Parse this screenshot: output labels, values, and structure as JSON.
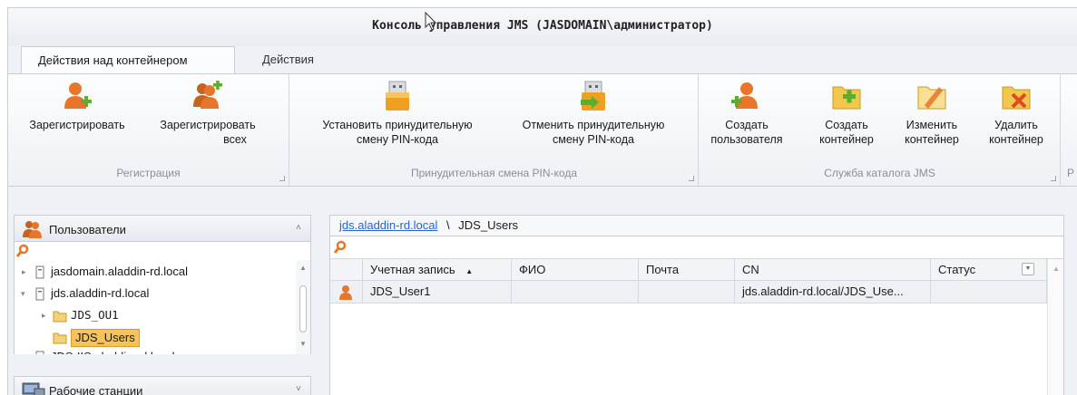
{
  "window": {
    "title": "Консоль управления JMS (JASDOMAIN\\администратор)"
  },
  "tabs": [
    {
      "label": "Действия над контейнером",
      "active": true
    },
    {
      "label": "Действия",
      "active": false
    }
  ],
  "ribbon": {
    "groups": [
      {
        "label": "Регистрация",
        "buttons": [
          {
            "line1": "Зарегистрировать",
            "line2": "",
            "icon": "register-user-icon"
          },
          {
            "line1": "Зарегистрировать",
            "line2": "всех",
            "icon": "register-all-users-icon"
          }
        ]
      },
      {
        "label": "Принудительная смена PIN-кода",
        "buttons": [
          {
            "line1": "Установить принудительную",
            "line2": "смену PIN-кода",
            "icon": "token-pin-set-icon"
          },
          {
            "line1": "Отменить принудительную",
            "line2": "смену PIN-кода",
            "icon": "token-pin-cancel-icon"
          }
        ]
      },
      {
        "label": "Служба каталога JMS",
        "buttons": [
          {
            "line1": "Создать",
            "line2": "пользователя",
            "icon": "create-user-icon"
          },
          {
            "line1": "Создать",
            "line2": "контейнер",
            "icon": "create-container-icon"
          },
          {
            "line1": "Изменить",
            "line2": "контейнер",
            "icon": "edit-container-icon"
          },
          {
            "line1": "Удалить",
            "line2": "контейнер",
            "icon": "delete-container-icon"
          }
        ]
      },
      {
        "label": "Р"
      }
    ]
  },
  "left_pane": {
    "header": "Пользователи",
    "tree": [
      {
        "label": "jasdomain.aladdin-rd.local",
        "expanded": false
      },
      {
        "label": "jds.aladdin-rd.local",
        "expanded": true
      },
      {
        "label": "JDS_OU1",
        "expanded": false
      },
      {
        "label": "JDS_Users",
        "selected": true
      },
      {
        "label": "JDS-IIS.aladdin-rd.local"
      }
    ],
    "second_header": "Рабочие станции"
  },
  "right_pane": {
    "breadcrumb": {
      "root": "jds.aladdin-rd.local",
      "separator": "\\",
      "current": "JDS_Users"
    },
    "columns": [
      "Учетная запись",
      "ФИО",
      "Почта",
      "CN",
      "Статус"
    ],
    "rows": [
      {
        "account": "JDS_User1",
        "fio": "",
        "mail": "",
        "cn": "jds.aladdin-rd.local/JDS_Use...",
        "status": ""
      }
    ]
  },
  "colors": {
    "selection": "#f6c35a",
    "link": "#2a63c9",
    "accent_orange": "#e8762a",
    "accent_green": "#5aae2e"
  }
}
